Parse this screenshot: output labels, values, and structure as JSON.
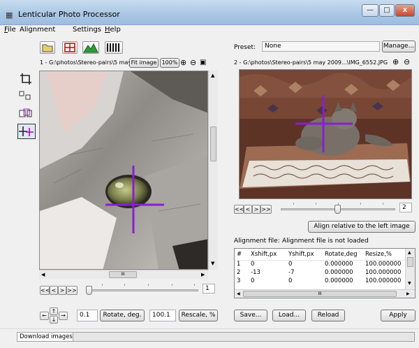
{
  "window": {
    "title": "Lenticular Photo Processor",
    "minimize_label": "—",
    "maximize_label": "□",
    "close_label": "x"
  },
  "menu": [
    {
      "label": "File",
      "u": "F",
      "rest": "ile"
    },
    {
      "label": "Alignment",
      "u": "",
      "rest": "Alignment"
    },
    {
      "label": "Settings",
      "u": "",
      "rest": "Settings"
    },
    {
      "label": "Help",
      "u": "H",
      "rest": "elp"
    }
  ],
  "left": {
    "path": "1 - G:\\photos\\Stereo-pairs\\5 may",
    "fit_image_label": "Fit image",
    "zoom_label": "100%",
    "frame_value": "1",
    "nav": [
      "<<",
      "<",
      ">",
      ">>"
    ]
  },
  "right": {
    "preset_label": "Preset:",
    "preset_value": "None",
    "manage_label": "Manage...",
    "path": "2 - G:\\photos\\Stereo-pairs\\5 may 2009...\\IMG_6552.JPG",
    "frame_value": "2",
    "nav": [
      "<<",
      "<",
      ">",
      ">>"
    ],
    "align_button_label": "Align relative to the left image"
  },
  "alignment": {
    "file_label": "Alignment file:",
    "file_status": "Alignment file is not loaded",
    "columns": [
      "#",
      "Xshift,px",
      "Yshift,px",
      "Rotate,deg",
      "Resize,%"
    ],
    "rows": [
      [
        "1",
        "0",
        "0",
        "0.000000",
        "100.000000"
      ],
      [
        "2",
        "-13",
        "-7",
        "0.000000",
        "100.000000"
      ],
      [
        "3",
        "0",
        "0",
        "0.000000",
        "100.000000"
      ]
    ],
    "hscroll_label": "III"
  },
  "bottom": {
    "rotate_value": "0.1",
    "rotate_label": "Rotate, deg.",
    "rescale_value": "100.1",
    "rescale_label": "Rescale, %",
    "save_label": "Save...",
    "load_label": "Load...",
    "reload_label": "Reload",
    "apply_label": "Apply"
  },
  "status": {
    "download_label": "Download images"
  },
  "left_scroll_label": "III"
}
